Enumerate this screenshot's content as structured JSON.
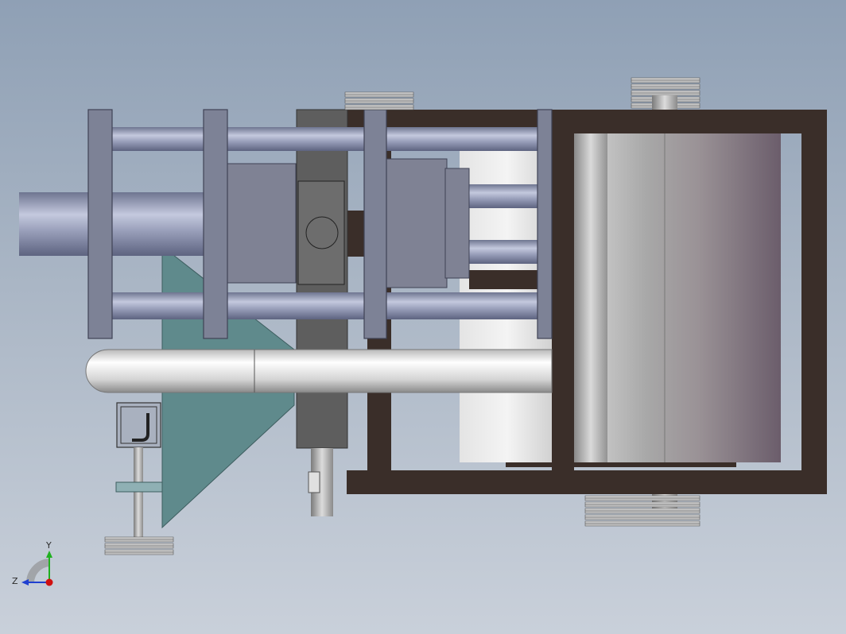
{
  "viewport": {
    "background_top": "#8fa0b5",
    "background_bottom": "#c9d0da"
  },
  "colors": {
    "frame": "#3a2e29",
    "plate": "#7d8296",
    "rod": "#9aa2bf",
    "block": "#7f8294",
    "column": "#5e5e5e",
    "triangle": "#5f8a8c",
    "roller_light": "#d9d9d9",
    "roller_mid": "#a4a4a4",
    "roller_dark": "#6e5c6c"
  },
  "triad": {
    "y_label": "Y",
    "z_label": "Z",
    "y_color": "#20b020",
    "z_color": "#2040d0",
    "origin_color": "#d01010"
  }
}
